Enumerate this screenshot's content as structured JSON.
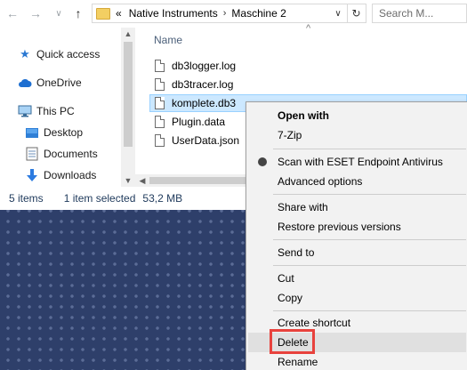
{
  "toolbar": {
    "back_glyph": "←",
    "forward_glyph": "→",
    "recent_glyph": "∨",
    "up_glyph": "↑"
  },
  "address": {
    "overflow": "«",
    "crumbs": [
      "Native Instruments",
      "Maschine 2"
    ],
    "separator": "›",
    "dropdown_glyph": "∨",
    "refresh_glyph": "↻"
  },
  "search": {
    "placeholder": "Search M..."
  },
  "sidebar": {
    "items": [
      {
        "label": "Quick access",
        "icon": "star-icon"
      },
      {
        "label": "OneDrive",
        "icon": "cloud-icon"
      },
      {
        "label": "This PC",
        "icon": "computer-icon"
      },
      {
        "label": "Desktop",
        "icon": "desktop-folder-icon"
      },
      {
        "label": "Documents",
        "icon": "documents-folder-icon"
      },
      {
        "label": "Downloads",
        "icon": "download-arrow-icon"
      }
    ]
  },
  "file_list": {
    "column_name": "Name",
    "sort_glyph": "^",
    "files": [
      {
        "name": "db3logger.log"
      },
      {
        "name": "db3tracer.log"
      },
      {
        "name": "komplete.db3",
        "selected": true
      },
      {
        "name": "Plugin.data"
      },
      {
        "name": "UserData.json"
      }
    ]
  },
  "status": {
    "item_count": "5 items",
    "selection": "1 item selected",
    "size": "53,2 MB"
  },
  "context_menu": {
    "items": [
      {
        "label": "Open with"
      },
      {
        "label": "7-Zip"
      },
      {
        "label": "Scan with ESET Endpoint Antivirus"
      },
      {
        "label": "Advanced options"
      },
      {
        "label": "Share with"
      },
      {
        "label": "Restore previous versions"
      },
      {
        "label": "Send to"
      },
      {
        "label": "Cut"
      },
      {
        "label": "Copy"
      },
      {
        "label": "Create shortcut"
      },
      {
        "label": "Delete"
      },
      {
        "label": "Rename"
      }
    ]
  },
  "colors": {
    "selection": "#cce8ff",
    "highlight_border": "#e8423d",
    "desktop_background": "#2e3f6a",
    "folder": "#f3cf62"
  }
}
